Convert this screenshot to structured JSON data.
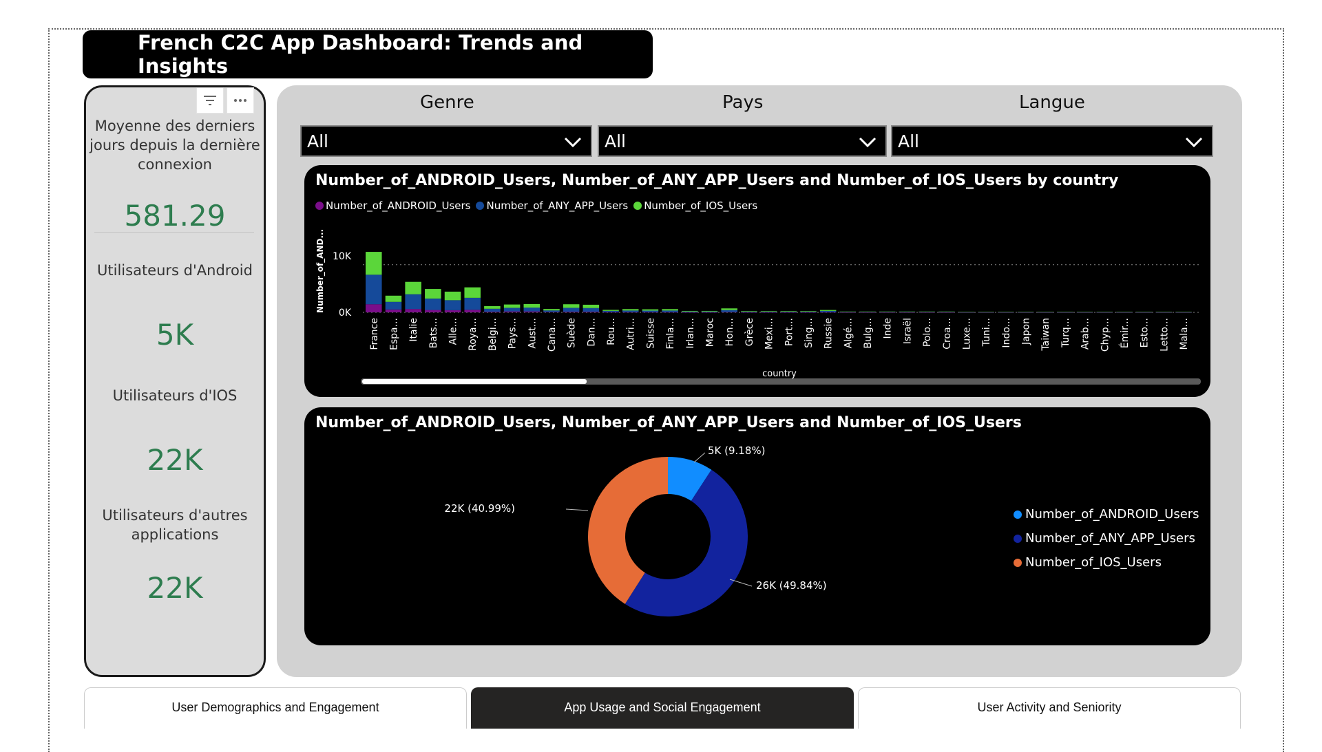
{
  "header": {
    "title": "French C2C App Dashboard: Trends and Insights"
  },
  "kpis": [
    {
      "label": "Moyenne des derniers jours depuis la dernière connexion",
      "value": "581.29"
    },
    {
      "label": "Utilisateurs d'Android",
      "value": "5K"
    },
    {
      "label": "Utilisateurs d'IOS",
      "value": "22K"
    },
    {
      "label": "Utilisateurs d'autres applications",
      "value": "22K"
    }
  ],
  "filters": {
    "genre": {
      "label": "Genre",
      "value": "All"
    },
    "pays": {
      "label": "Pays",
      "value": "All"
    },
    "langue": {
      "label": "Langue",
      "value": "All"
    }
  },
  "icons": {
    "filter": "filter-icon",
    "more": "more-options-icon",
    "chevron": "chevron-down-icon"
  },
  "colors": {
    "android": "#7a0e8a",
    "any_app": "#154a9a",
    "ios": "#5bd63a",
    "kpi_value": "#2e7d4f",
    "pie_android": "#118dff",
    "pie_any": "#12239e",
    "pie_ios": "#e66c37"
  },
  "bar_chart_title": "Number_of_ANDROID_Users, Number_of_ANY_APP_Users and Number_of_IOS_Users by country",
  "pie_chart_title": "Number_of_ANDROID_Users, Number_of_ANY_APP_Users and Number_of_IOS_Users",
  "chart_data": [
    {
      "type": "bar",
      "stacked": true,
      "title": "Number_of_ANDROID_Users, Number_of_ANY_APP_Users and Number_of_IOS_Users by country",
      "xlabel": "country",
      "ylabel": "Number_of_AND...",
      "y_ticks": [
        "0K",
        "10K"
      ],
      "ylim": [
        0,
        13000
      ],
      "legend_position": "top-left",
      "categories": [
        "France",
        "Espa...",
        "Italie",
        "Bats...",
        "Alle...",
        "Roya...",
        "Belgi...",
        "Pays...",
        "Aust...",
        "Cana...",
        "Suède",
        "Dan...",
        "Rou...",
        "Autri...",
        "Suisse",
        "Finla...",
        "Irlan...",
        "Maroc",
        "Hon...",
        "Grèce",
        "Mexi...",
        "Port...",
        "Sing...",
        "Russie",
        "Algé...",
        "Bulg...",
        "Inde",
        "Israël",
        "Polo...",
        "Croa...",
        "Luxe...",
        "Tuni...",
        "Indo...",
        "Japon",
        "Taiwan",
        "Turq...",
        "Arab...",
        "Chyp...",
        "Émir...",
        "Esto...",
        "Letto...",
        "Mala..."
      ],
      "series": [
        {
          "name": "Number_of_ANDROID_Users",
          "values": [
            1700,
            600,
            700,
            500,
            450,
            550,
            150,
            200,
            200,
            100,
            150,
            150,
            60,
            60,
            60,
            60,
            30,
            30,
            80,
            30,
            30,
            30,
            30,
            50,
            20,
            20,
            20,
            20,
            20,
            20,
            10,
            10,
            10,
            10,
            10,
            10,
            10,
            10,
            10,
            10,
            10,
            10
          ]
        },
        {
          "name": "Number_of_ANY_APP_Users",
          "values": [
            6200,
            1600,
            3100,
            2400,
            2100,
            2500,
            600,
            750,
            800,
            300,
            800,
            750,
            250,
            320,
            300,
            320,
            150,
            150,
            400,
            120,
            120,
            120,
            120,
            250,
            80,
            80,
            80,
            80,
            80,
            80,
            50,
            50,
            50,
            50,
            50,
            50,
            50,
            50,
            50,
            50,
            50,
            50
          ]
        },
        {
          "name": "Number_of_IOS_Users",
          "values": [
            4800,
            1300,
            2600,
            2000,
            1800,
            2200,
            550,
            700,
            750,
            300,
            750,
            700,
            220,
            300,
            280,
            300,
            120,
            120,
            350,
            100,
            100,
            100,
            100,
            200,
            70,
            70,
            70,
            70,
            70,
            70,
            40,
            40,
            40,
            40,
            40,
            40,
            40,
            40,
            40,
            40,
            40,
            40
          ]
        }
      ]
    },
    {
      "type": "pie",
      "donut": true,
      "title": "Number_of_ANDROID_Users, Number_of_ANY_APP_Users and Number_of_IOS_Users",
      "legend_position": "right",
      "slices": [
        {
          "name": "Number_of_ANDROID_Users",
          "value": 5000,
          "percent": 9.18,
          "label": "5K (9.18%)",
          "color": "#118dff"
        },
        {
          "name": "Number_of_ANY_APP_Users",
          "value": 26000,
          "percent": 49.84,
          "label": "26K (49.84%)",
          "color": "#12239e"
        },
        {
          "name": "Number_of_IOS_Users",
          "value": 22000,
          "percent": 40.99,
          "label": "22K (40.99%)",
          "color": "#e66c37"
        }
      ]
    }
  ],
  "tabs": [
    {
      "label": "User Demographics and Engagement",
      "active": false
    },
    {
      "label": "App Usage and Social Engagement",
      "active": true
    },
    {
      "label": "User Activity and Seniority",
      "active": false
    }
  ]
}
